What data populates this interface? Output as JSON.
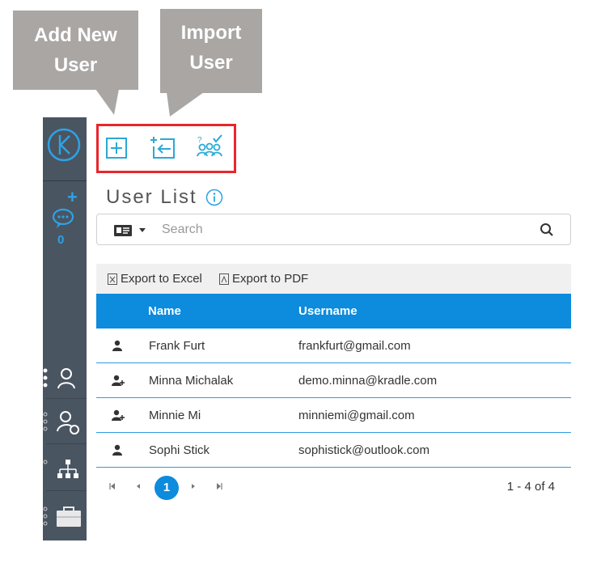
{
  "callouts": {
    "add_new_user": "Add New User",
    "import_user": "Import User"
  },
  "sidebar": {
    "chat_count": "0",
    "nav_items": [
      {
        "icon": "user-icon"
      },
      {
        "icon": "user-settings-icon"
      },
      {
        "icon": "org-chart-icon"
      },
      {
        "icon": "briefcase-icon"
      }
    ]
  },
  "toolbar": {
    "buttons": [
      {
        "icon": "add-icon"
      },
      {
        "icon": "import-icon"
      },
      {
        "icon": "user-group-check-icon"
      }
    ]
  },
  "page": {
    "title": "User List"
  },
  "search": {
    "placeholder": "Search",
    "value": ""
  },
  "grid": {
    "export_excel": "Export to Excel",
    "export_pdf": "Export to PDF",
    "columns": [
      "Name",
      "Username"
    ],
    "rows": [
      {
        "icon": "user-icon",
        "name": "Frank Furt",
        "username": "frankfurt@gmail.com"
      },
      {
        "icon": "user-add-icon",
        "name": "Minna Michalak",
        "username": "demo.minna@kradle.com"
      },
      {
        "icon": "user-add-icon",
        "name": "Minnie Mi",
        "username": "minniemi@gmail.com"
      },
      {
        "icon": "user-icon",
        "name": "Sophi Stick",
        "username": "sophistick@outlook.com"
      }
    ],
    "pager": {
      "current_page": "1",
      "info": "1 - 4 of 4"
    }
  },
  "colors": {
    "accent": "#0d8bdc",
    "sidebar": "#4a5562",
    "highlight_border": "#e8262a",
    "callout": "#a9a6a3"
  }
}
